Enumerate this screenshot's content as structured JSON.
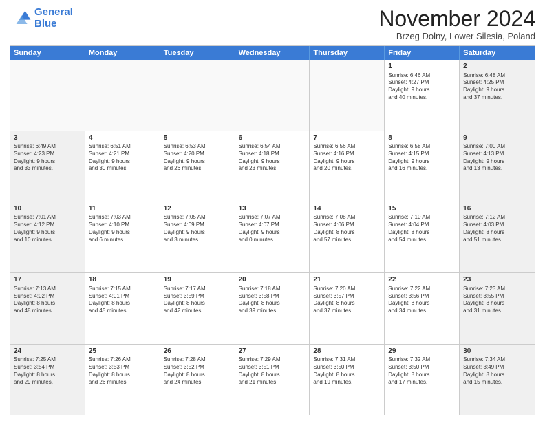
{
  "header": {
    "logo_line1": "General",
    "logo_line2": "Blue",
    "month_title": "November 2024",
    "location": "Brzeg Dolny, Lower Silesia, Poland"
  },
  "days_of_week": [
    "Sunday",
    "Monday",
    "Tuesday",
    "Wednesday",
    "Thursday",
    "Friday",
    "Saturday"
  ],
  "weeks": [
    [
      {
        "day": "",
        "info": "",
        "empty": true
      },
      {
        "day": "",
        "info": "",
        "empty": true
      },
      {
        "day": "",
        "info": "",
        "empty": true
      },
      {
        "day": "",
        "info": "",
        "empty": true
      },
      {
        "day": "",
        "info": "",
        "empty": true
      },
      {
        "day": "1",
        "info": "Sunrise: 6:46 AM\nSunset: 4:27 PM\nDaylight: 9 hours\nand 40 minutes."
      },
      {
        "day": "2",
        "info": "Sunrise: 6:48 AM\nSunset: 4:25 PM\nDaylight: 9 hours\nand 37 minutes."
      }
    ],
    [
      {
        "day": "3",
        "info": "Sunrise: 6:49 AM\nSunset: 4:23 PM\nDaylight: 9 hours\nand 33 minutes."
      },
      {
        "day": "4",
        "info": "Sunrise: 6:51 AM\nSunset: 4:21 PM\nDaylight: 9 hours\nand 30 minutes."
      },
      {
        "day": "5",
        "info": "Sunrise: 6:53 AM\nSunset: 4:20 PM\nDaylight: 9 hours\nand 26 minutes."
      },
      {
        "day": "6",
        "info": "Sunrise: 6:54 AM\nSunset: 4:18 PM\nDaylight: 9 hours\nand 23 minutes."
      },
      {
        "day": "7",
        "info": "Sunrise: 6:56 AM\nSunset: 4:16 PM\nDaylight: 9 hours\nand 20 minutes."
      },
      {
        "day": "8",
        "info": "Sunrise: 6:58 AM\nSunset: 4:15 PM\nDaylight: 9 hours\nand 16 minutes."
      },
      {
        "day": "9",
        "info": "Sunrise: 7:00 AM\nSunset: 4:13 PM\nDaylight: 9 hours\nand 13 minutes."
      }
    ],
    [
      {
        "day": "10",
        "info": "Sunrise: 7:01 AM\nSunset: 4:12 PM\nDaylight: 9 hours\nand 10 minutes."
      },
      {
        "day": "11",
        "info": "Sunrise: 7:03 AM\nSunset: 4:10 PM\nDaylight: 9 hours\nand 6 minutes."
      },
      {
        "day": "12",
        "info": "Sunrise: 7:05 AM\nSunset: 4:09 PM\nDaylight: 9 hours\nand 3 minutes."
      },
      {
        "day": "13",
        "info": "Sunrise: 7:07 AM\nSunset: 4:07 PM\nDaylight: 9 hours\nand 0 minutes."
      },
      {
        "day": "14",
        "info": "Sunrise: 7:08 AM\nSunset: 4:06 PM\nDaylight: 8 hours\nand 57 minutes."
      },
      {
        "day": "15",
        "info": "Sunrise: 7:10 AM\nSunset: 4:04 PM\nDaylight: 8 hours\nand 54 minutes."
      },
      {
        "day": "16",
        "info": "Sunrise: 7:12 AM\nSunset: 4:03 PM\nDaylight: 8 hours\nand 51 minutes."
      }
    ],
    [
      {
        "day": "17",
        "info": "Sunrise: 7:13 AM\nSunset: 4:02 PM\nDaylight: 8 hours\nand 48 minutes."
      },
      {
        "day": "18",
        "info": "Sunrise: 7:15 AM\nSunset: 4:01 PM\nDaylight: 8 hours\nand 45 minutes."
      },
      {
        "day": "19",
        "info": "Sunrise: 7:17 AM\nSunset: 3:59 PM\nDaylight: 8 hours\nand 42 minutes."
      },
      {
        "day": "20",
        "info": "Sunrise: 7:18 AM\nSunset: 3:58 PM\nDaylight: 8 hours\nand 39 minutes."
      },
      {
        "day": "21",
        "info": "Sunrise: 7:20 AM\nSunset: 3:57 PM\nDaylight: 8 hours\nand 37 minutes."
      },
      {
        "day": "22",
        "info": "Sunrise: 7:22 AM\nSunset: 3:56 PM\nDaylight: 8 hours\nand 34 minutes."
      },
      {
        "day": "23",
        "info": "Sunrise: 7:23 AM\nSunset: 3:55 PM\nDaylight: 8 hours\nand 31 minutes."
      }
    ],
    [
      {
        "day": "24",
        "info": "Sunrise: 7:25 AM\nSunset: 3:54 PM\nDaylight: 8 hours\nand 29 minutes."
      },
      {
        "day": "25",
        "info": "Sunrise: 7:26 AM\nSunset: 3:53 PM\nDaylight: 8 hours\nand 26 minutes."
      },
      {
        "day": "26",
        "info": "Sunrise: 7:28 AM\nSunset: 3:52 PM\nDaylight: 8 hours\nand 24 minutes."
      },
      {
        "day": "27",
        "info": "Sunrise: 7:29 AM\nSunset: 3:51 PM\nDaylight: 8 hours\nand 21 minutes."
      },
      {
        "day": "28",
        "info": "Sunrise: 7:31 AM\nSunset: 3:50 PM\nDaylight: 8 hours\nand 19 minutes."
      },
      {
        "day": "29",
        "info": "Sunrise: 7:32 AM\nSunset: 3:50 PM\nDaylight: 8 hours\nand 17 minutes."
      },
      {
        "day": "30",
        "info": "Sunrise: 7:34 AM\nSunset: 3:49 PM\nDaylight: 8 hours\nand 15 minutes."
      }
    ]
  ]
}
